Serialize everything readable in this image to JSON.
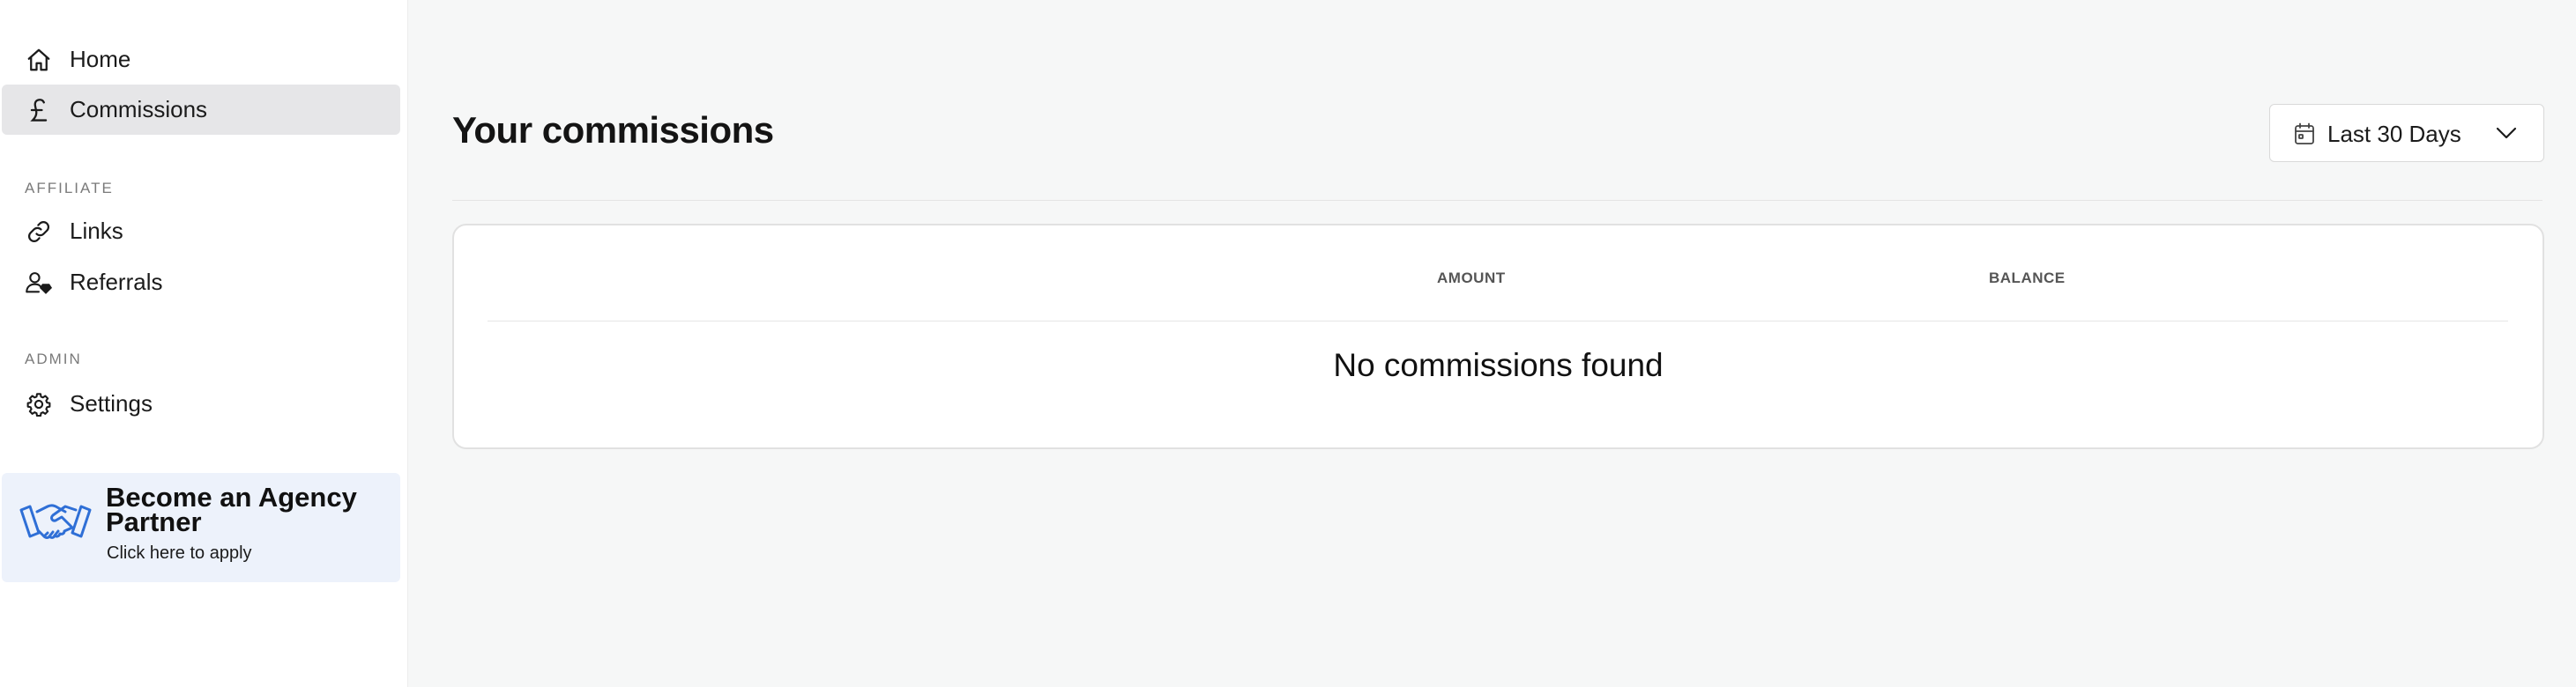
{
  "sidebar": {
    "items": [
      {
        "label": "Home",
        "icon": "home-icon"
      },
      {
        "label": "Commissions",
        "icon": "pound-icon",
        "active": true
      }
    ],
    "affiliate_section": {
      "label": "AFFILIATE",
      "items": [
        {
          "label": "Links",
          "icon": "link-icon"
        },
        {
          "label": "Referrals",
          "icon": "referrals-icon"
        }
      ]
    },
    "admin_section": {
      "label": "ADMIN",
      "items": [
        {
          "label": "Settings",
          "icon": "gear-icon"
        }
      ]
    },
    "promo": {
      "title": "Become an Agency Partner",
      "subtitle": "Click here to apply",
      "icon": "handshake-icon"
    }
  },
  "main": {
    "title": "Your commissions",
    "date_range": {
      "value": "Last 30 Days",
      "icon": "calendar-icon"
    },
    "table": {
      "columns": [
        "AMOUNT",
        "BALANCE"
      ],
      "empty_message": "No commissions found"
    }
  },
  "colors": {
    "active_bg": "#e6e6e8",
    "promo_bg": "#edf2fb",
    "promo_icon": "#2f6fd6",
    "main_bg": "#f6f7f7"
  }
}
